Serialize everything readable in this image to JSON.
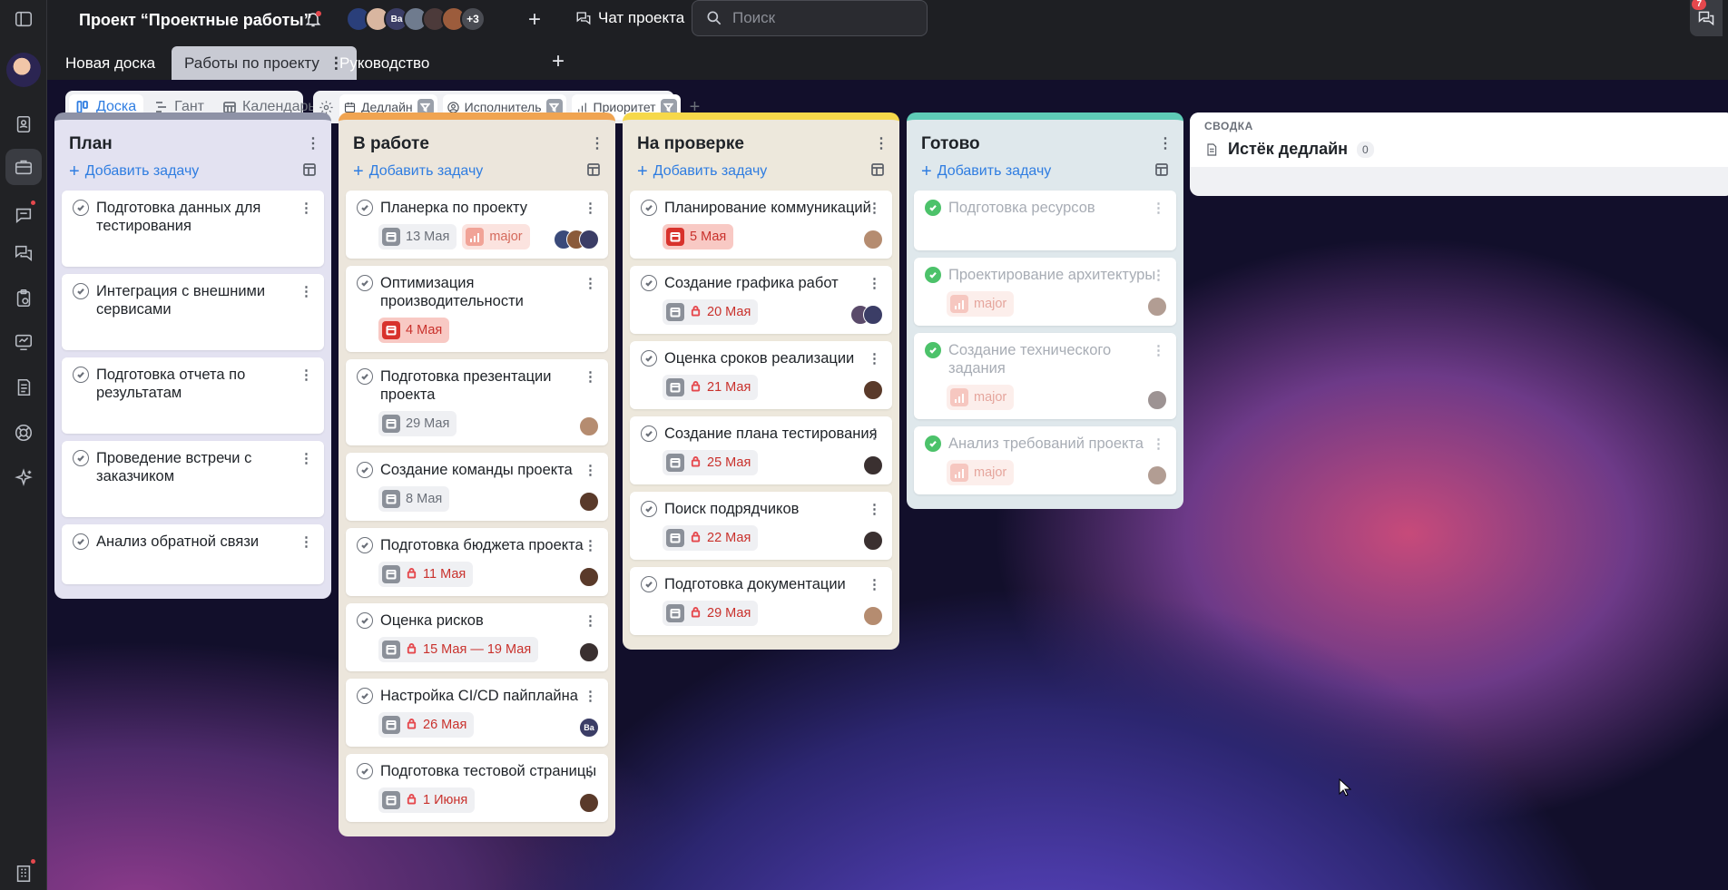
{
  "project": {
    "title": "Проект “Проектные работы”",
    "members_more": "+3"
  },
  "members": [
    {
      "initials": "",
      "color": "#2a3f7a"
    },
    {
      "initials": "",
      "color": "#d9b6a0"
    },
    {
      "initials": "Ва",
      "color": "#3b3d66"
    },
    {
      "initials": "",
      "color": "#6f7b8e"
    },
    {
      "initials": "",
      "color": "#4c3a3a"
    },
    {
      "initials": "",
      "color": "#9c5c3c"
    }
  ],
  "chat": {
    "label": "Чат проекта",
    "mention": "@"
  },
  "search": {
    "placeholder": "Поиск"
  },
  "notifications_count": "7",
  "tabs": [
    {
      "label": "Новая доска"
    },
    {
      "label": "Работы по проекту",
      "active": true
    },
    {
      "label": "Руководство"
    }
  ],
  "views": [
    {
      "label": "Доска",
      "active": true
    },
    {
      "label": "Гант"
    },
    {
      "label": "Календарь"
    }
  ],
  "filters": [
    {
      "label": "Дедлайн"
    },
    {
      "label": "Исполнитель"
    },
    {
      "label": "Приоритет"
    }
  ],
  "add_task_label": "Добавить задачу",
  "columns": [
    {
      "title": "План",
      "accent": "#8e92a6",
      "bg": "#e3e2f1",
      "cards": [
        {
          "title": "Подготовка данных для тестирования",
          "tall": true
        },
        {
          "title": "Интеграция с внешними сервисами",
          "tall": true
        },
        {
          "title": "Подготовка отчета по результатам",
          "tall": true
        },
        {
          "title": "Проведение встречи с заказчиком",
          "tall": true
        },
        {
          "title": "Анализ обратной связи",
          "tall": true
        }
      ]
    },
    {
      "title": "В работе",
      "accent": "#f0a451",
      "bg": "#ece6dc",
      "cards": [
        {
          "title": "Планерка по проекту",
          "date": "13 Мая",
          "priority": "major",
          "avatars": [
            "#3a4a7a",
            "#8a5a3a",
            "#3b3d66"
          ]
        },
        {
          "title": "Оптимизация производительности",
          "date": "4 Мая",
          "date_style": "overdue"
        },
        {
          "title": "Подготовка презентации проекта",
          "date": "29 Мая",
          "avatars": [
            "#b58c70"
          ]
        },
        {
          "title": "Создание команды проекта",
          "date": "8 Мая",
          "avatars": [
            "#5a3a2a"
          ]
        },
        {
          "title": "Подготовка бюджета проекта",
          "date": "11 Мая",
          "date_style": "locked",
          "avatars": [
            "#5a3a2a"
          ]
        },
        {
          "title": "Оценка рисков",
          "date": "15 Мая — 19 Мая",
          "date_style": "locked",
          "avatars": [
            "#3a3030"
          ]
        },
        {
          "title": "Настройка CI/CD пайплайна",
          "date": "26 Мая",
          "date_style": "locked",
          "avatars": [
            "#3b3d66"
          ],
          "avatar_text": "Ва"
        },
        {
          "title": "Подготовка тестовой страницы",
          "date": "1 Июня",
          "date_style": "locked",
          "avatars": [
            "#5a3a2a"
          ]
        }
      ]
    },
    {
      "title": "На проверке",
      "accent": "#f6d84a",
      "bg": "#ede8dc",
      "cards": [
        {
          "title": "Планирование коммуникаций",
          "date": "5 Мая",
          "date_style": "overdue",
          "avatars": [
            "#b58c70"
          ]
        },
        {
          "title": "Создание графика работ",
          "date": "20 Мая",
          "date_style": "locked",
          "avatars": [
            "#5a4a6a",
            "#3b3d66"
          ]
        },
        {
          "title": "Оценка сроков реализации",
          "date": "21 Мая",
          "date_style": "locked",
          "avatars": [
            "#5a3a2a"
          ]
        },
        {
          "title": "Создание плана тестирования",
          "date": "25 Мая",
          "date_style": "locked",
          "avatars": [
            "#3a3030"
          ]
        },
        {
          "title": "Поиск подрядчиков",
          "date": "22 Мая",
          "date_style": "locked",
          "avatars": [
            "#3a3030"
          ]
        },
        {
          "title": "Подготовка документации",
          "date": "29 Мая",
          "date_style": "locked",
          "avatars": [
            "#b58c70"
          ]
        }
      ]
    },
    {
      "title": "Готово",
      "accent": "#5ecbb6",
      "bg": "#dfe8ec",
      "cards": [
        {
          "title": "Подготовка ресурсов",
          "done": true,
          "tall": true
        },
        {
          "title": "Проектирование архитектуры",
          "done": true,
          "priority": "major",
          "avatars": [
            "#8a6a5a"
          ]
        },
        {
          "title": "Создание технического задания",
          "done": true,
          "priority": "major",
          "avatars": [
            "#6a5a5a"
          ]
        },
        {
          "title": "Анализ требований проекта",
          "done": true,
          "priority": "major",
          "avatars": [
            "#8a6a5a"
          ]
        }
      ]
    }
  ],
  "summary": {
    "label": "СВОДКА",
    "title": "Истёк дедлайн",
    "count": "0"
  }
}
